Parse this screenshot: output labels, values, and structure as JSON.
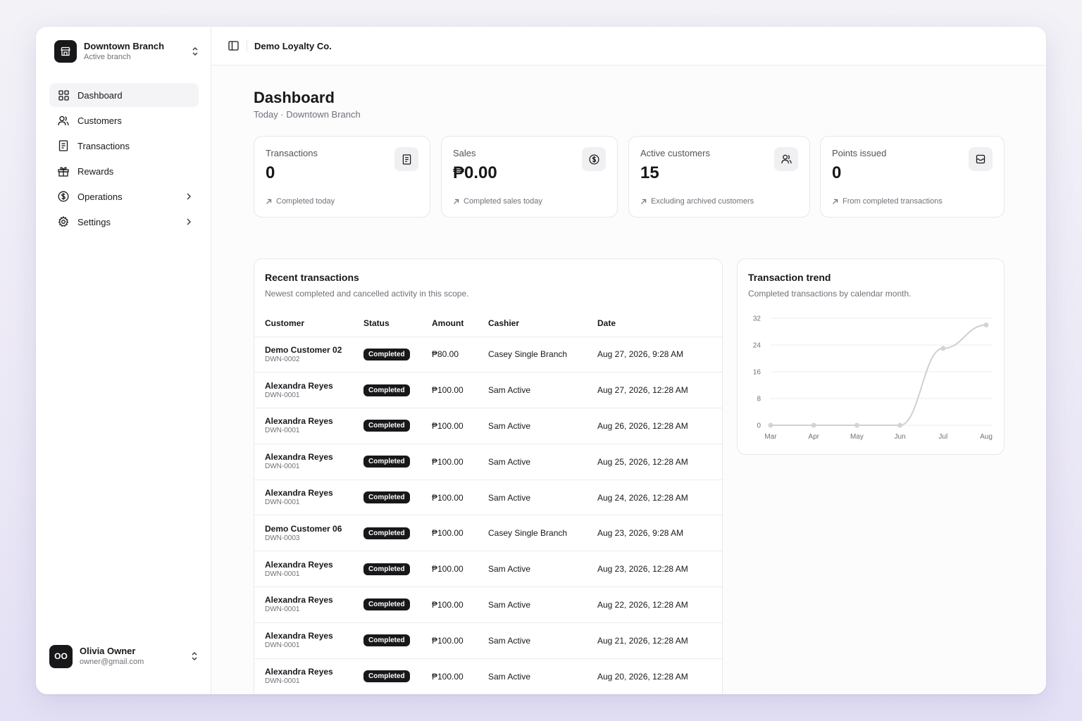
{
  "branch": {
    "name": "Downtown Branch",
    "subtitle": "Active branch"
  },
  "nav": [
    {
      "label": "Dashboard",
      "icon": "grid-icon",
      "active": true
    },
    {
      "label": "Customers",
      "icon": "users-icon"
    },
    {
      "label": "Transactions",
      "icon": "receipt-icon"
    },
    {
      "label": "Rewards",
      "icon": "gift-icon"
    },
    {
      "label": "Operations",
      "icon": "dollar-circle-icon",
      "has_submenu": true
    },
    {
      "label": "Settings",
      "icon": "gear-icon",
      "has_submenu": true
    }
  ],
  "user": {
    "initials": "OO",
    "name": "Olivia Owner",
    "email": "owner@gmail.com"
  },
  "topbar": {
    "org_name": "Demo Loyalty Co."
  },
  "page": {
    "title": "Dashboard",
    "subtitle": "Today · Downtown Branch"
  },
  "stats": [
    {
      "label": "Transactions",
      "value": "0",
      "foot": "Completed today",
      "icon": "receipt-icon"
    },
    {
      "label": "Sales",
      "value": "₱0.00",
      "foot": "Completed sales today",
      "icon": "dollar-circle-icon"
    },
    {
      "label": "Active customers",
      "value": "15",
      "foot": "Excluding archived customers",
      "icon": "users-icon"
    },
    {
      "label": "Points issued",
      "value": "0",
      "foot": "From completed transactions",
      "icon": "inbox-icon"
    }
  ],
  "recent": {
    "title": "Recent transactions",
    "subtitle": "Newest completed and cancelled activity in this scope.",
    "columns": [
      "Customer",
      "Status",
      "Amount",
      "Cashier",
      "Date"
    ],
    "rows": [
      {
        "customer": "Demo Customer 02",
        "id": "DWN-0002",
        "status": "Completed",
        "amount": "₱80.00",
        "cashier": "Casey Single Branch",
        "date": "Aug 27, 2026, 9:28 AM"
      },
      {
        "customer": "Alexandra Reyes",
        "id": "DWN-0001",
        "status": "Completed",
        "amount": "₱100.00",
        "cashier": "Sam Active",
        "date": "Aug 27, 2026, 12:28 AM"
      },
      {
        "customer": "Alexandra Reyes",
        "id": "DWN-0001",
        "status": "Completed",
        "amount": "₱100.00",
        "cashier": "Sam Active",
        "date": "Aug 26, 2026, 12:28 AM"
      },
      {
        "customer": "Alexandra Reyes",
        "id": "DWN-0001",
        "status": "Completed",
        "amount": "₱100.00",
        "cashier": "Sam Active",
        "date": "Aug 25, 2026, 12:28 AM"
      },
      {
        "customer": "Alexandra Reyes",
        "id": "DWN-0001",
        "status": "Completed",
        "amount": "₱100.00",
        "cashier": "Sam Active",
        "date": "Aug 24, 2026, 12:28 AM"
      },
      {
        "customer": "Demo Customer 06",
        "id": "DWN-0003",
        "status": "Completed",
        "amount": "₱100.00",
        "cashier": "Casey Single Branch",
        "date": "Aug 23, 2026, 9:28 AM"
      },
      {
        "customer": "Alexandra Reyes",
        "id": "DWN-0001",
        "status": "Completed",
        "amount": "₱100.00",
        "cashier": "Sam Active",
        "date": "Aug 23, 2026, 12:28 AM"
      },
      {
        "customer": "Alexandra Reyes",
        "id": "DWN-0001",
        "status": "Completed",
        "amount": "₱100.00",
        "cashier": "Sam Active",
        "date": "Aug 22, 2026, 12:28 AM"
      },
      {
        "customer": "Alexandra Reyes",
        "id": "DWN-0001",
        "status": "Completed",
        "amount": "₱100.00",
        "cashier": "Sam Active",
        "date": "Aug 21, 2026, 12:28 AM"
      },
      {
        "customer": "Alexandra Reyes",
        "id": "DWN-0001",
        "status": "Completed",
        "amount": "₱100.00",
        "cashier": "Sam Active",
        "date": "Aug 20, 2026, 12:28 AM"
      }
    ]
  },
  "trend": {
    "title": "Transaction trend",
    "subtitle": "Completed transactions by calendar month."
  },
  "chart_data": {
    "type": "line",
    "title": "Transaction trend",
    "categories": [
      "Mar",
      "Apr",
      "May",
      "Jun",
      "Jul",
      "Aug"
    ],
    "series": [
      {
        "values": [
          0,
          0,
          0,
          0,
          23,
          30
        ]
      }
    ],
    "yticks": [
      0,
      8,
      16,
      24,
      32
    ],
    "ylim": [
      0,
      32
    ],
    "grid": true,
    "line_color": "#cfcfd4"
  },
  "colors": {
    "accent": "#18181b",
    "muted": "#71717a",
    "border": "#e8e8eb"
  }
}
